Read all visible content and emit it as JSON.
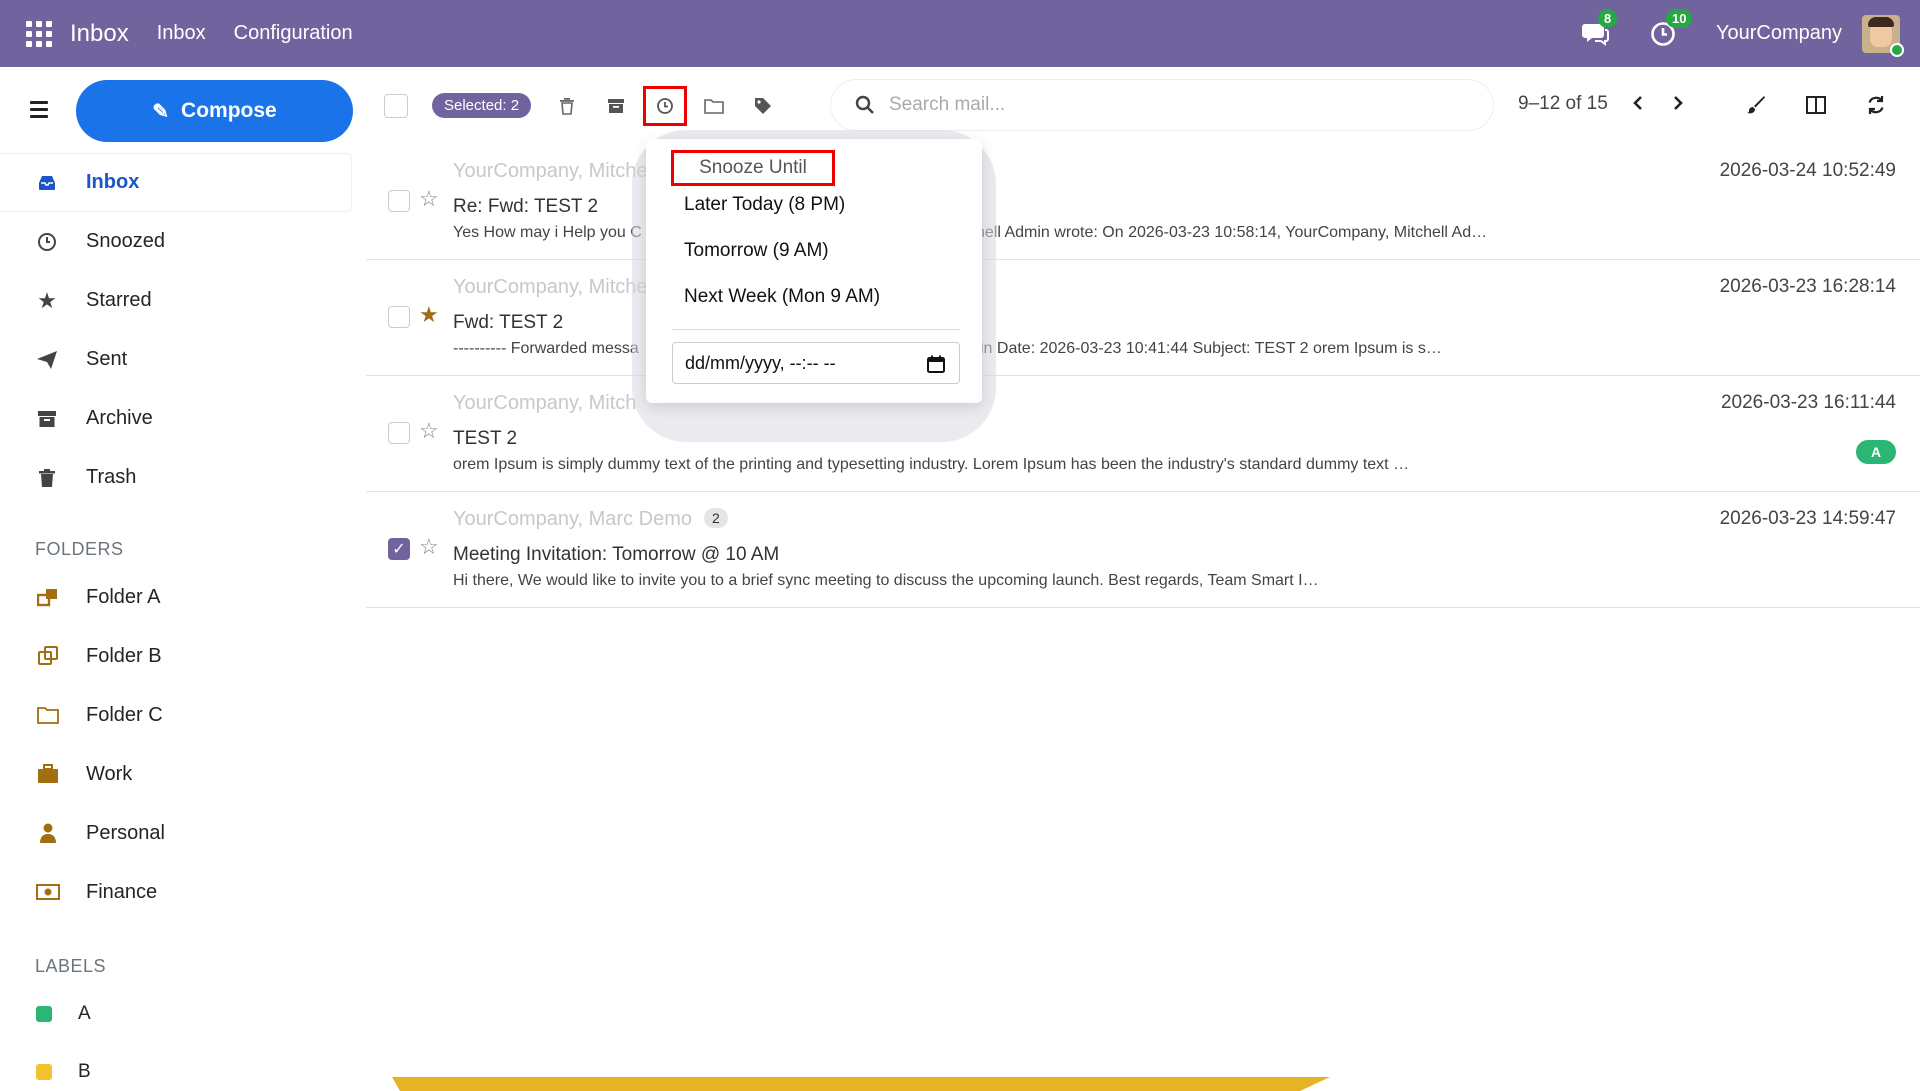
{
  "navbar": {
    "brand": "Inbox",
    "menu": [
      "Inbox",
      "Configuration"
    ],
    "messages_count": "8",
    "activities_count": "10",
    "company": "YourCompany"
  },
  "sidebar": {
    "compose_label": "Compose",
    "items": [
      {
        "label": "Inbox",
        "icon": "inbox-icon",
        "active": true
      },
      {
        "label": "Snoozed",
        "icon": "clock-icon"
      },
      {
        "label": "Starred",
        "icon": "star-icon"
      },
      {
        "label": "Sent",
        "icon": "paper-plane-icon"
      },
      {
        "label": "Archive",
        "icon": "archive-icon"
      },
      {
        "label": "Trash",
        "icon": "trash-icon"
      }
    ],
    "folders_title": "FOLDERS",
    "folders": [
      {
        "label": "Folder A",
        "icon": "folder-multi-icon"
      },
      {
        "label": "Folder B",
        "icon": "folder-copy-icon"
      },
      {
        "label": "Folder C",
        "icon": "folder-icon"
      },
      {
        "label": "Work",
        "icon": "briefcase-icon"
      },
      {
        "label": "Personal",
        "icon": "user-icon"
      },
      {
        "label": "Finance",
        "icon": "money-icon"
      }
    ],
    "labels_title": "LABELS",
    "labels": [
      {
        "label": "A",
        "color": "#2bb673"
      },
      {
        "label": "B",
        "color": "#f2c12e"
      }
    ]
  },
  "toolbar": {
    "selected": "Selected: 2",
    "search_placeholder": "Search mail...",
    "pager": "9–12 of 15"
  },
  "snooze": {
    "title": "Snooze Until",
    "options": [
      "Later Today (8 PM)",
      "Tomorrow (9 AM)",
      "Next Week (Mon 9 AM)"
    ],
    "datetime_placeholder": "dd/mm/yyyy, --:-- --"
  },
  "mails": [
    {
      "from": "YourCompany, Mitche",
      "subject": "Re: Fwd: TEST 2",
      "preview_left": "Yes How may i Help you C",
      "preview_right": "hell Admin wrote: On 2026-03-23 10:58:14, YourCompany, Mitchell Ad…",
      "date": "2026-03-24 10:52:49",
      "starred": false,
      "checked": false
    },
    {
      "from": "YourCompany, Mitche",
      "subject": "Fwd: TEST 2",
      "preview_left": "---------- Forwarded messa",
      "preview_right": "in Date: 2026-03-23 10:41:44 Subject: TEST 2 orem Ipsum is s…",
      "date": "2026-03-23 16:28:14",
      "starred": true,
      "checked": false
    },
    {
      "from": "YourCompany, Mitch",
      "subject": "TEST 2",
      "preview": "orem Ipsum is simply dummy text of the printing and typesetting industry. Lorem Ipsum has been the industry's standard dummy text …",
      "date": "2026-03-23 16:11:44",
      "tag": "A",
      "starred": false,
      "checked": false
    },
    {
      "from": "YourCompany, Marc Demo",
      "count": "2",
      "subject": "Meeting Invitation: Tomorrow @ 10 AM",
      "preview": "Hi there, We would like to invite you to a brief sync meeting to discuss the upcoming launch. Best regards, Team Smart I…",
      "date": "2026-03-23 14:59:47",
      "starred": false,
      "checked": true
    }
  ],
  "colors": {
    "navbar": "#71639e",
    "compose": "#1a73e8",
    "accent_red": "#ee0000",
    "decor_yellow": "#f2c12e"
  }
}
